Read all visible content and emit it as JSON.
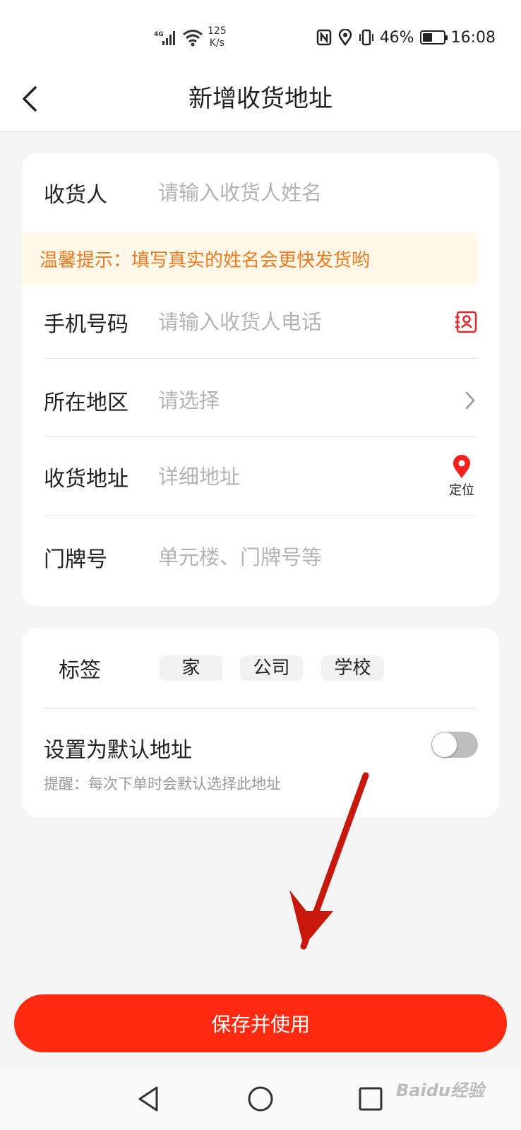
{
  "status_bar": {
    "network": "4G",
    "speed_value": "125",
    "speed_unit": "K/s",
    "battery": "46%",
    "battery_level": 0.46,
    "time": "16:08"
  },
  "header": {
    "title": "新增收货地址"
  },
  "form": {
    "recipient": {
      "label": "收货人",
      "placeholder": "请输入收货人姓名",
      "value": ""
    },
    "tip": "温馨提示：填写真实的姓名会更快发货哟",
    "phone": {
      "label": "手机号码",
      "placeholder": "请输入收货人电话",
      "value": ""
    },
    "region": {
      "label": "所在地区",
      "placeholder": "请选择",
      "value": ""
    },
    "address": {
      "label": "收货地址",
      "placeholder": "详细地址",
      "value": "",
      "locate_label": "定位"
    },
    "door": {
      "label": "门牌号",
      "placeholder": "单元楼、门牌号等",
      "value": ""
    }
  },
  "tags": {
    "label": "标签",
    "items": [
      "家",
      "公司",
      "学校"
    ]
  },
  "default_address": {
    "title": "设置为默认地址",
    "hint": "提醒：每次下单时会默认选择此地址",
    "enabled": false
  },
  "save_button": {
    "label": "保存并使用"
  },
  "watermark": "Baidu经验",
  "colors": {
    "accent": "#ff2a10",
    "tip_text": "#f07a20",
    "tip_bg": "#fff8e8",
    "pin": "#f4221b"
  },
  "icons": {
    "back": "chevron-left-icon",
    "contact": "contact-book-icon",
    "region": "chevron-right-icon",
    "locate": "location-pin-icon"
  }
}
